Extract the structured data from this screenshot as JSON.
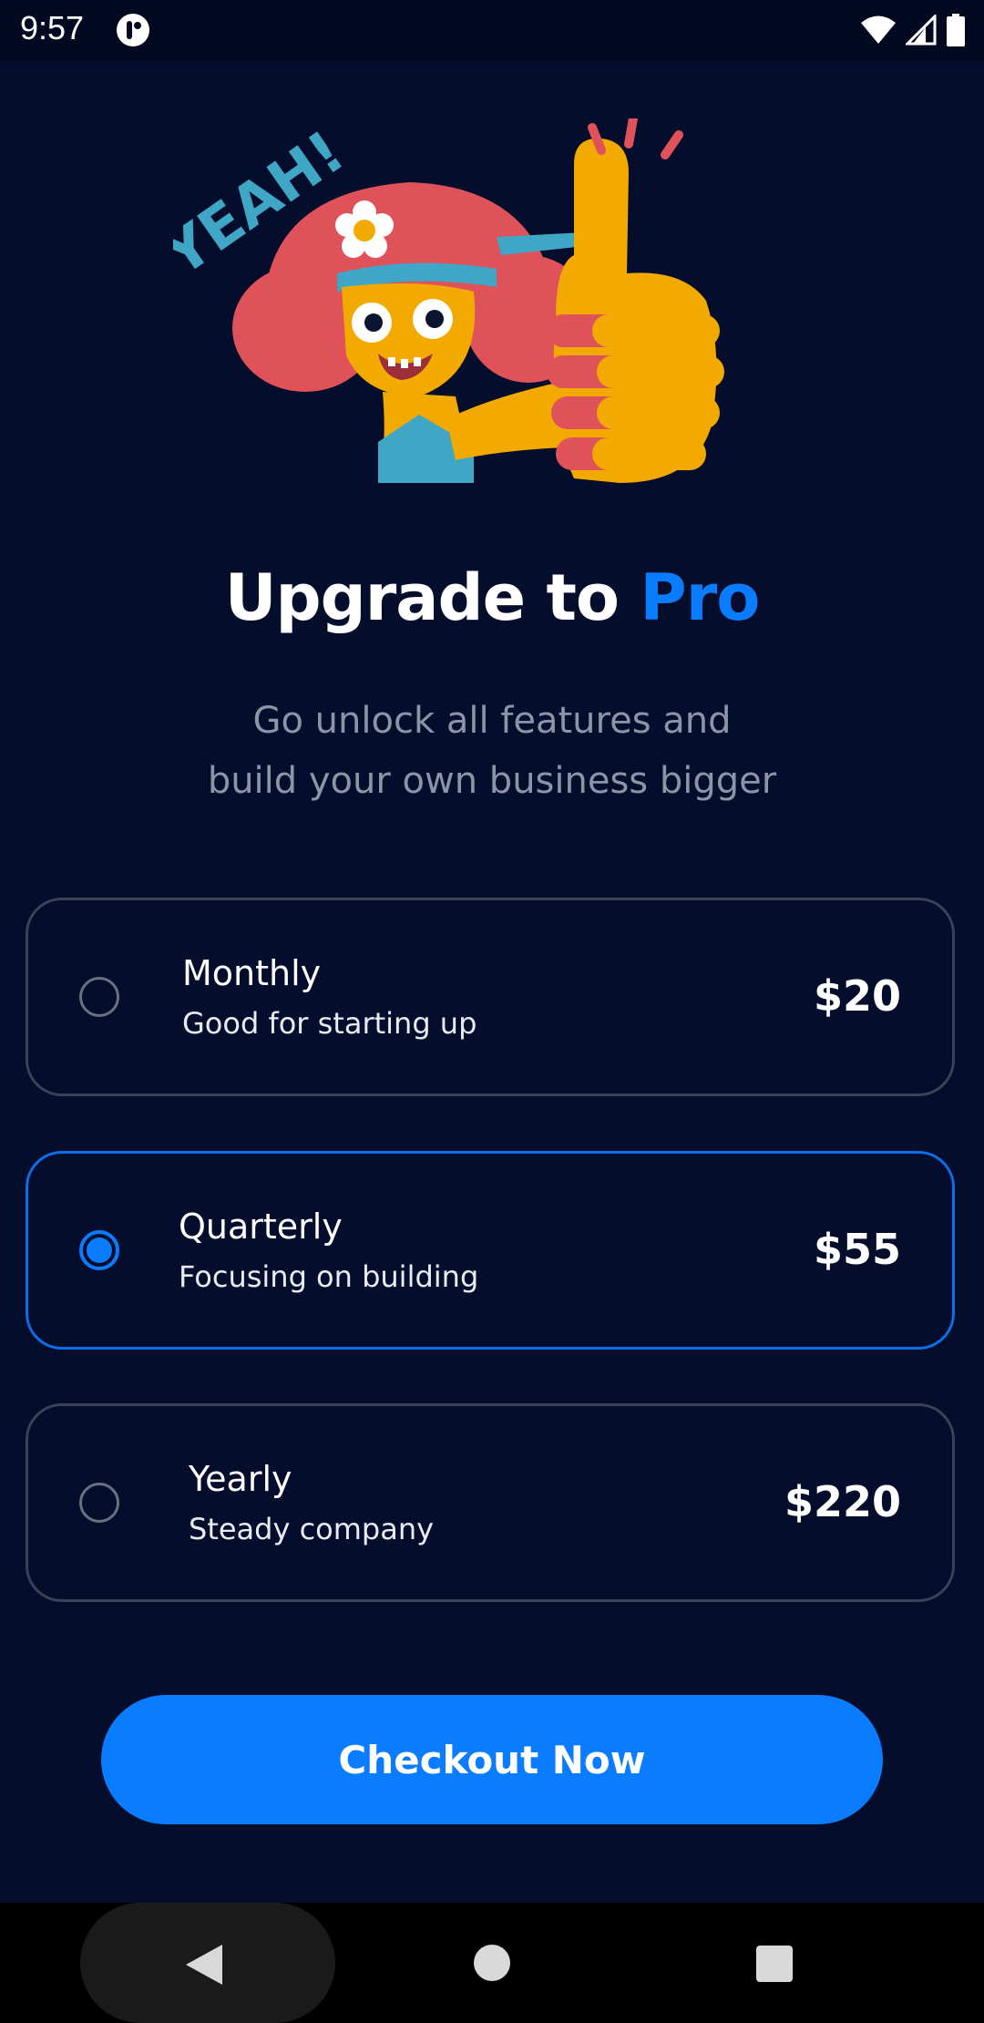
{
  "status_bar": {
    "time": "9:57",
    "icons": [
      "app-notification-icon",
      "wifi-icon",
      "signal-icon",
      "battery-icon"
    ]
  },
  "hero": {
    "illustration": "cartoon-girl-thumbs-up",
    "caption": "YEAH!"
  },
  "title": {
    "prefix": "Upgrade to ",
    "accent": "Pro"
  },
  "subtitle": {
    "line1": "Go unlock all features and",
    "line2": "build your own business bigger"
  },
  "plans": [
    {
      "name": "Monthly",
      "description": "Good for starting up",
      "price": "$20",
      "selected": false
    },
    {
      "name": "Quarterly",
      "description": "Focusing on building",
      "price": "$55",
      "selected": true
    },
    {
      "name": "Yearly",
      "description": "Steady company",
      "price": "$220",
      "selected": false
    }
  ],
  "checkout": {
    "label": "Checkout Now"
  },
  "nav_bar": {
    "icons": [
      "back-icon",
      "home-icon",
      "recents-icon"
    ]
  },
  "colors": {
    "background": "#040d2b",
    "accent": "#0a7cff",
    "card_border": "#3b4257",
    "muted_text": "#8c94a8"
  }
}
